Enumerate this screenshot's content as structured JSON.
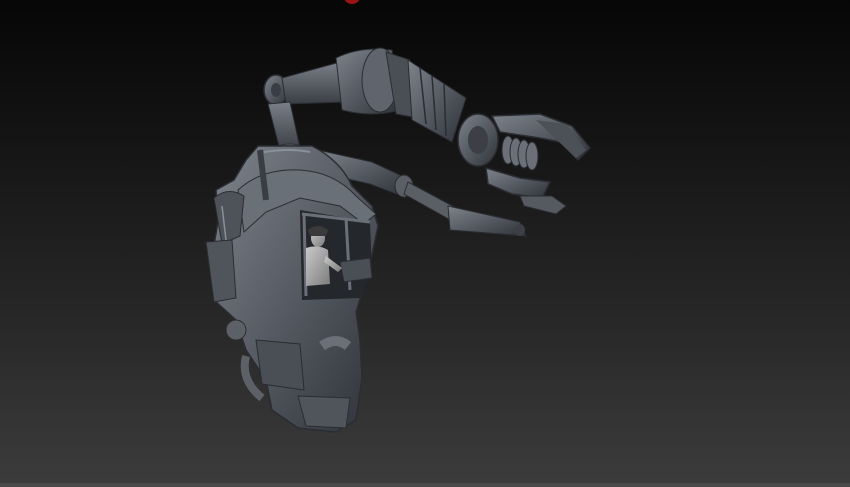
{
  "viewport": {
    "background_top": "#060606",
    "background_bottom": "#3c3c3c",
    "model_color": "#5b6068",
    "model_shadow": "#30343a",
    "model_highlight": "#8a9098",
    "indicator_color": "#9a1414"
  },
  "icons": [
    "red-indicator-icon"
  ]
}
